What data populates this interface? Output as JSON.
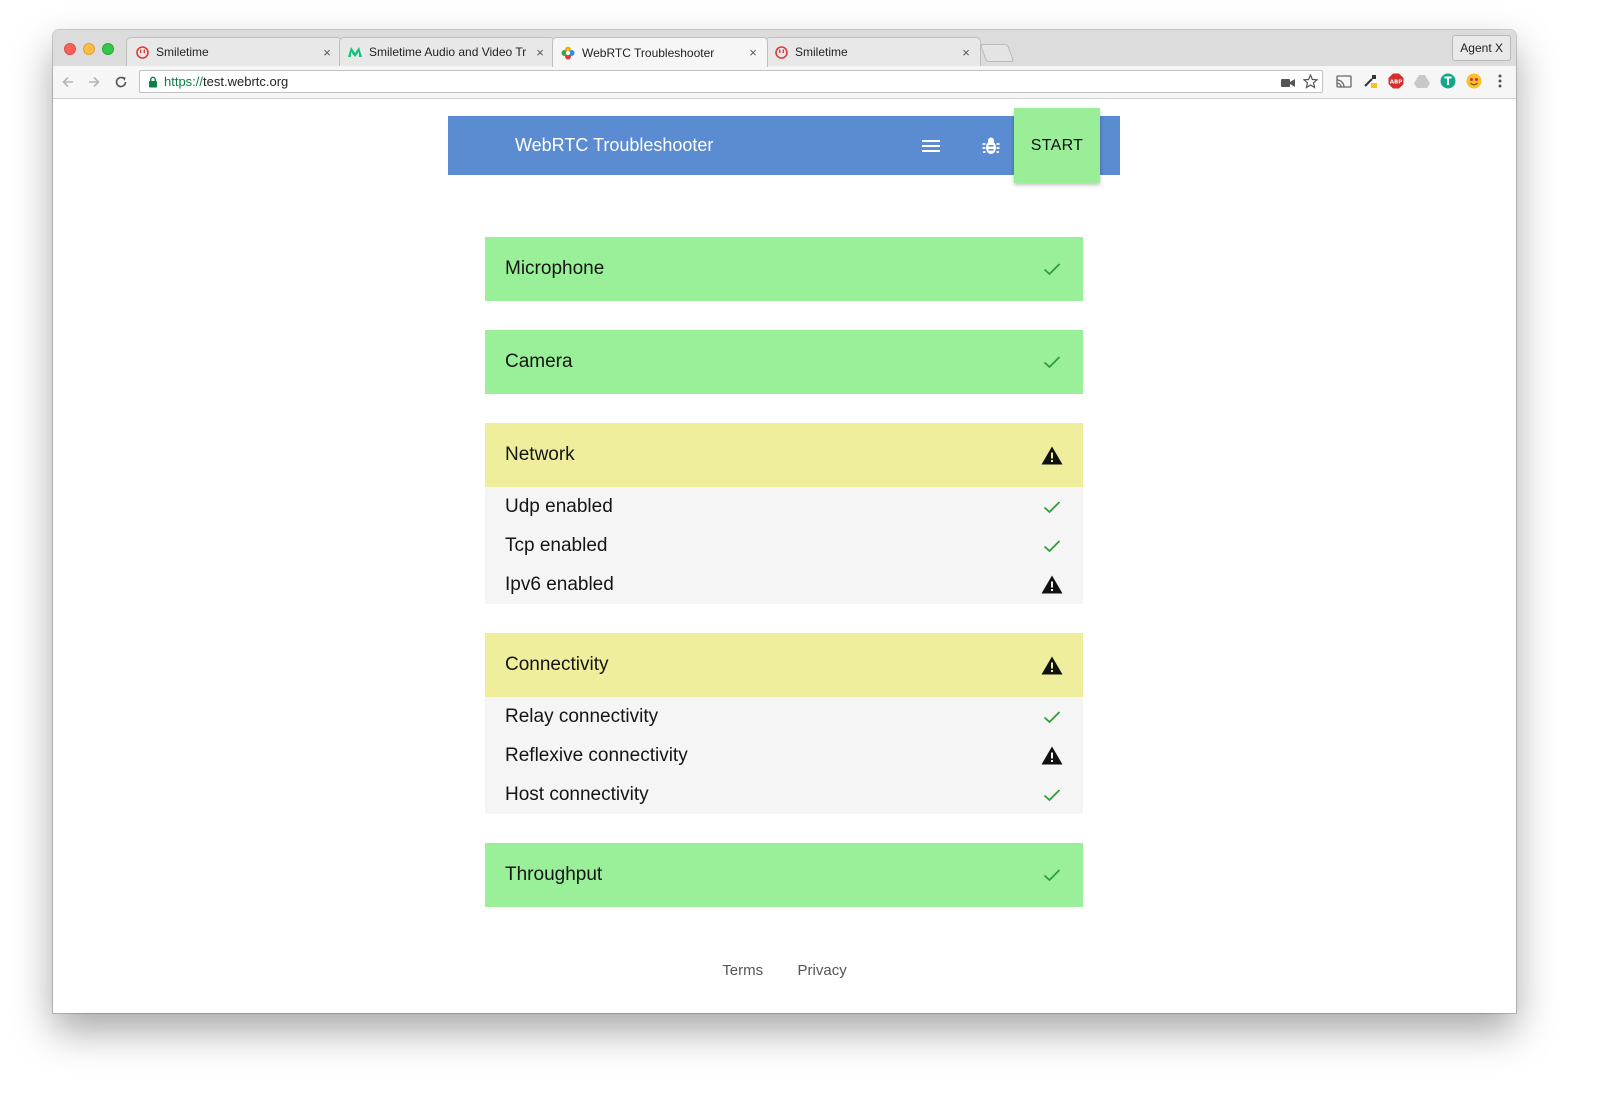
{
  "browser": {
    "tabs": [
      {
        "title": "Smiletime",
        "close": "×",
        "icon": "smiletime-icon"
      },
      {
        "title": "Smiletime Audio and Video Tr",
        "close": "×",
        "icon": "medium-icon"
      },
      {
        "title": "WebRTC Troubleshooter",
        "close": "×",
        "icon": "webrtc-icon"
      },
      {
        "title": "Smiletime",
        "close": "×",
        "icon": "smiletime-icon"
      }
    ],
    "profile_label": "Agent X",
    "url_scheme": "https://",
    "url_host": "test.webrtc.org"
  },
  "appbar": {
    "title": "WebRTC Troubleshooter",
    "start_label": "START"
  },
  "sections": {
    "microphone": {
      "label": "Microphone",
      "status": "ok"
    },
    "camera": {
      "label": "Camera",
      "status": "ok"
    },
    "network": {
      "label": "Network",
      "status": "warning",
      "items": [
        {
          "label": "Udp enabled",
          "status": "ok"
        },
        {
          "label": "Tcp enabled",
          "status": "ok"
        },
        {
          "label": "Ipv6 enabled",
          "status": "warning"
        }
      ]
    },
    "connectivity": {
      "label": "Connectivity",
      "status": "warning",
      "items": [
        {
          "label": "Relay connectivity",
          "status": "ok"
        },
        {
          "label": "Reflexive connectivity",
          "status": "warning"
        },
        {
          "label": "Host connectivity",
          "status": "ok"
        }
      ]
    },
    "throughput": {
      "label": "Throughput",
      "status": "ok"
    }
  },
  "footer": {
    "terms": "Terms",
    "privacy": "Privacy"
  },
  "colors": {
    "appbar": "#5b8bd0",
    "ok_bg": "#9af098",
    "warn_bg": "#eeee9c",
    "check": "#2e9e3a"
  }
}
